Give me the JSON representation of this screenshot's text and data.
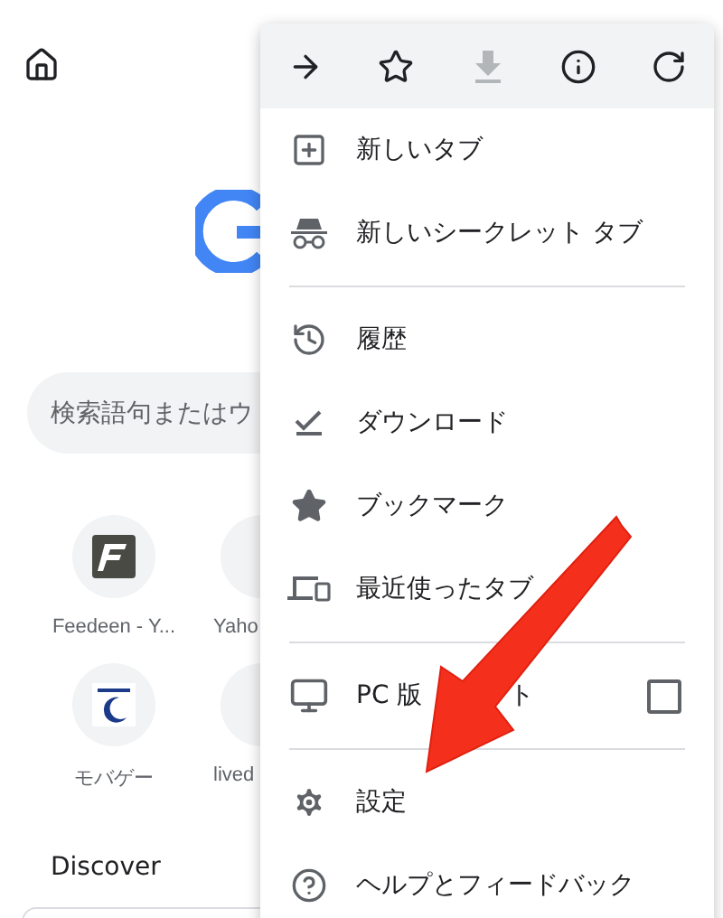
{
  "page": {
    "search": {
      "placeholder": "検索語句またはウ"
    },
    "tiles": [
      {
        "label": "Feedeen - Y...",
        "kind": "feedeen"
      },
      {
        "label": "Yaho",
        "kind": "covered"
      },
      {
        "label": "モバゲー",
        "kind": "mobage"
      },
      {
        "label": "lived",
        "kind": "covered"
      }
    ],
    "discover": "Discover"
  },
  "menu": {
    "toolbar": [
      {
        "kind": "forward",
        "disabled": false
      },
      {
        "kind": "bookmark",
        "disabled": false
      },
      {
        "kind": "download",
        "disabled": true
      },
      {
        "kind": "info",
        "disabled": false
      },
      {
        "kind": "reload",
        "disabled": false
      }
    ],
    "items": [
      {
        "label": "新しいタブ",
        "kind": "new-tab",
        "divider_before": false
      },
      {
        "label": "新しいシークレット タブ",
        "kind": "incognito",
        "divider_before": false
      },
      {
        "label": "履歴",
        "kind": "history",
        "divider_before": true
      },
      {
        "label": "ダウンロード",
        "kind": "downloads",
        "divider_before": false
      },
      {
        "label": "ブックマーク",
        "kind": "bookmarks",
        "divider_before": false
      },
      {
        "label": "最近使ったタブ",
        "kind": "recent",
        "divider_before": false
      },
      {
        "label": "PC 版",
        "label_tail": "ト",
        "kind": "desktop",
        "divider_before": true,
        "checked": false
      },
      {
        "label": "設定",
        "kind": "settings",
        "divider_before": true
      },
      {
        "label": "ヘルプとフィードバック",
        "kind": "help",
        "divider_before": false
      }
    ]
  }
}
